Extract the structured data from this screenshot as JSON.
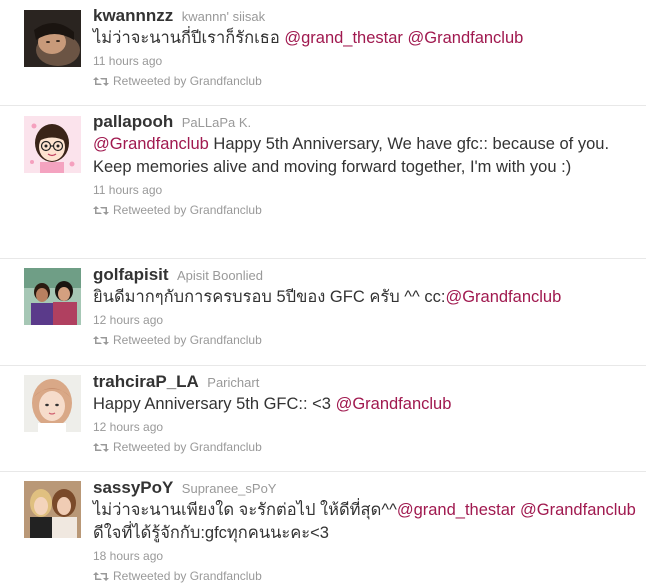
{
  "retweeted_by_label": "Retweeted by Grandfanclub",
  "tweets": [
    {
      "screen_name": "kwannnzz",
      "full_name": "kwannn' siisak",
      "text_before": "ไม่ว่าจะนานกี่ปีเราก็รักเธอ ",
      "mention1": "@grand_thestar",
      "text_between": " ",
      "mention2": "@Grandfanclub",
      "text_after": "",
      "time": "11 hours ago"
    },
    {
      "screen_name": "pallapooh",
      "full_name": "PaLLaPa K.",
      "mention1": "@Grandfanclub",
      "text_after": " Happy 5th Anniversary, We have gfc:: because of you. Keep memories alive and moving forward together, I'm with you :)",
      "time": "11 hours ago"
    },
    {
      "screen_name": "golfapisit",
      "full_name": "Apisit Boonlied",
      "text_before": "ยินดีมากๆกับการครบรอบ 5ปีของ GFC ครับ ^^ cc:",
      "mention1": "@Grandfanclub",
      "time": "12 hours ago"
    },
    {
      "screen_name": "trahciraP_LA",
      "full_name": "Parichart",
      "text_before": "Happy Anniversary 5th GFC:: <3 ",
      "mention1": "@Grandfanclub",
      "time": "12 hours ago"
    },
    {
      "screen_name": "sassyPoY",
      "full_name": "Supranee_sPoY",
      "text_before": "ไม่ว่าจะนานเพียงใด จะรักต่อไป ให้ดีที่สุด^^",
      "mention1": "@grand_thestar",
      "text_between": " ",
      "mention2": "@Grandfanclub",
      "text_after": " ดีใจที่ได้รู้จักกับ:gfcทุกคนนะคะ<3",
      "time": "18 hours ago"
    }
  ]
}
